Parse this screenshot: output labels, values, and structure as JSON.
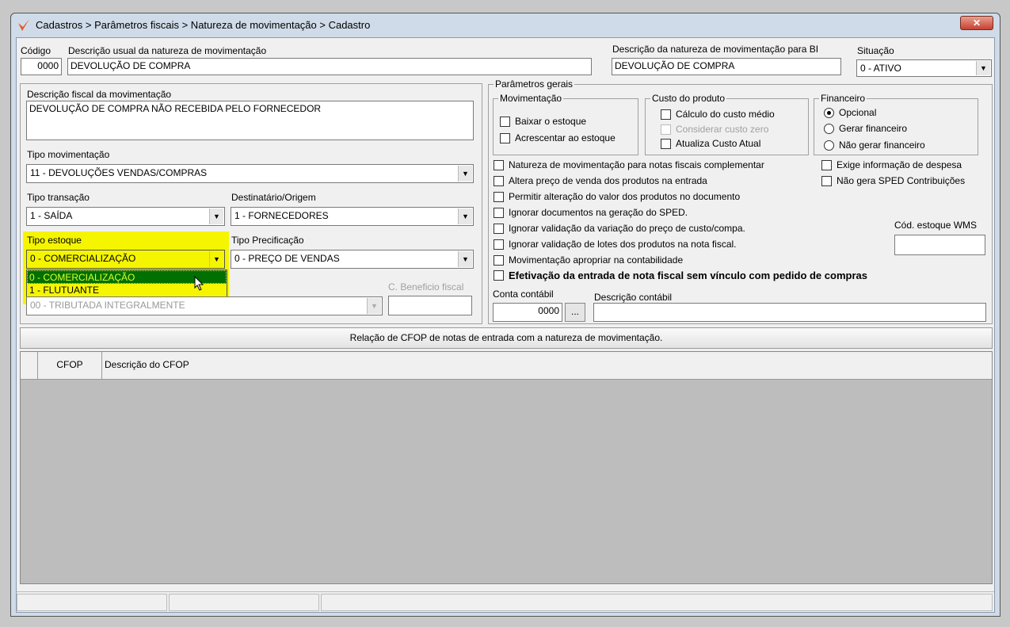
{
  "window": {
    "title": "Cadastros > Parâmetros fiscais > Natureza de movimentação > Cadastro",
    "close_icon": "close-icon"
  },
  "codigo": {
    "label": "Código",
    "value": "0000"
  },
  "descricao_usual": {
    "label": "Descrição usual da natureza de movimentação",
    "value": "DEVOLUÇÃO DE COMPRA"
  },
  "descricao_bi": {
    "label": "Descrição da natureza de movimentação para BI",
    "value": "DEVOLUÇÃO DE COMPRA"
  },
  "situacao": {
    "label": "Situação",
    "value": "0 - ATIVO"
  },
  "descricao_fiscal": {
    "label": "Descrição fiscal da movimentação",
    "value": "DEVOLUÇÃO DE COMPRA NÃO RECEBIDA PELO FORNECEDOR"
  },
  "tipo_movimentacao": {
    "label": "Tipo movimentação",
    "value": "11 - DEVOLUÇÕES VENDAS/COMPRAS"
  },
  "tipo_transacao": {
    "label": "Tipo transação",
    "value": "1 - SAÍDA"
  },
  "destinatario": {
    "label": "Destinatário/Origem",
    "value": "1 - FORNECEDORES"
  },
  "tipo_estoque": {
    "label": "Tipo estoque",
    "value": "0 - COMERCIALIZAÇÃO",
    "options": [
      "0 - COMERCIALIZAÇÃO",
      "1 - FLUTUANTE"
    ]
  },
  "tipo_precificacao": {
    "label": "Tipo Precificação",
    "value": "0 - PREÇO DE VENDAS"
  },
  "tributacao": {
    "value": "00 - TRIBUTADA INTEGRALMENTE"
  },
  "beneficio": {
    "label": "C. Beneficio fiscal",
    "value": ""
  },
  "parametros": {
    "title": "Parâmetros gerais",
    "movimentacao": {
      "title": "Movimentação",
      "items": [
        "Baixar o estoque",
        "Acrescentar ao estoque"
      ]
    },
    "custo": {
      "title": "Custo do produto",
      "items": [
        "Cálculo do custo médio",
        "Considerar custo zero",
        "Atualiza Custo Atual"
      ]
    },
    "financeiro": {
      "title": "Financeiro",
      "options": [
        "Opcional",
        "Gerar financeiro",
        "Não gerar financeiro"
      ],
      "selected": "Opcional"
    },
    "checks": [
      "Natureza de movimentação para notas fiscais complementar",
      "Altera preço de venda dos produtos na entrada",
      "Permitir alteração do valor dos produtos no documento",
      "Ignorar documentos na geração do SPED.",
      "Ignorar validação da variação do preço de custo/compa.",
      "Ignorar validação de lotes dos produtos na nota fiscal.",
      "Movimentação apropriar na contabilidade",
      "Efetivação da entrada de nota fiscal sem vínculo com pedido de compras"
    ],
    "right_checks": [
      "Exige informação de despesa",
      "Não gera SPED Contribuições"
    ],
    "wms_label": "Cód. estoque WMS",
    "wms_value": "",
    "conta_label": "Conta contábil",
    "conta_value": "0000",
    "conta_btn": "...",
    "desc_contabil_label": "Descrição contábil",
    "desc_contabil_value": ""
  },
  "cfop": {
    "button": "Relação de CFOP de notas de entrada com a natureza de movimentação.",
    "columns": [
      "CFOP",
      "Descrição do CFOP"
    ]
  },
  "colors": {
    "highlight": "#f5f500",
    "selected": "#007000",
    "selected_text": "#d8ff30",
    "accent": "#e8562a"
  }
}
